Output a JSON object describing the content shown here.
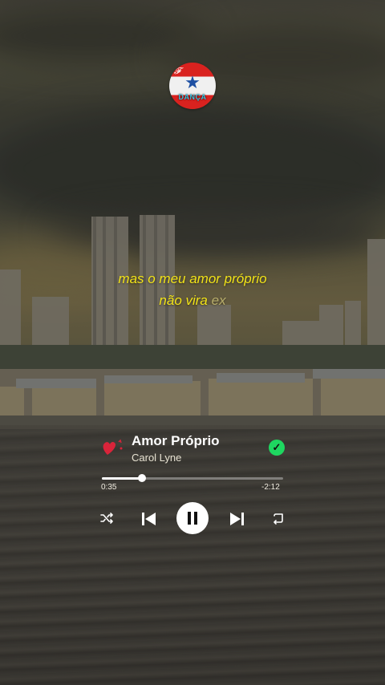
{
  "app": {
    "logo_label": "DANÇA"
  },
  "lyrics": {
    "line1": "mas o meu amor próprio",
    "line2_main": "não vira",
    "line2_next": "ex"
  },
  "track": {
    "title": "Amor Próprio",
    "artist": "Carol Lyne",
    "saved": true,
    "elapsed": "0:35",
    "remaining": "-2:12",
    "progress": 0.22
  },
  "controls": {
    "shuffle": "shuffle-icon",
    "previous": "skip-previous-icon",
    "play_state": "pause-icon",
    "next": "skip-next-icon",
    "repeat": "repeat-icon"
  },
  "colors": {
    "lyric": "#f2e318",
    "accent": "#1ed760"
  }
}
